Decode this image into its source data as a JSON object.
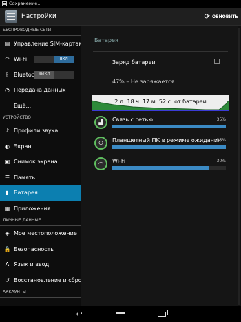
{
  "statusbar": {
    "notification": "Сохранение..."
  },
  "actionbar": {
    "title": "Настройки",
    "refresh_label": "ОБНОВИТЬ"
  },
  "sidebar": {
    "sections": [
      {
        "header": "БЕСПРОВОДНЫЕ СЕТИ",
        "items": [
          {
            "name": "sim",
            "icon": "sim-card-icon",
            "label": "Управление SIM-картами"
          },
          {
            "name": "wifi",
            "icon": "wifi-icon",
            "label": "Wi-Fi",
            "toggle": {
              "state": "on",
              "on_label": "ВКЛ",
              "off_label": ""
            }
          },
          {
            "name": "bluetooth",
            "icon": "bluetooth-icon",
            "label": "Bluetooth",
            "toggle": {
              "state": "off",
              "on_label": "",
              "off_label": "ВЫКЛ"
            }
          },
          {
            "name": "data",
            "icon": "data-transfer-icon",
            "label": "Передача данных"
          },
          {
            "name": "more",
            "icon": "",
            "label": "Ещё..."
          }
        ]
      },
      {
        "header": "УСТРОЙСТВО",
        "items": [
          {
            "name": "sound",
            "icon": "sound-profile-icon",
            "label": "Профили звука"
          },
          {
            "name": "display",
            "icon": "display-icon",
            "label": "Экран"
          },
          {
            "name": "screenshot",
            "icon": "camera-icon",
            "label": "Снимок экрана"
          },
          {
            "name": "storage",
            "icon": "storage-icon",
            "label": "Память"
          },
          {
            "name": "battery",
            "icon": "battery-icon",
            "label": "Батарея",
            "selected": true
          },
          {
            "name": "apps",
            "icon": "apps-icon",
            "label": "Приложения"
          }
        ]
      },
      {
        "header": "ЛИЧНЫЕ ДАННЫЕ",
        "items": [
          {
            "name": "location",
            "icon": "location-icon",
            "label": "Мое местоположение"
          },
          {
            "name": "security",
            "icon": "lock-icon",
            "label": "Безопасность"
          },
          {
            "name": "language",
            "icon": "language-icon",
            "label": "Язык и ввод"
          },
          {
            "name": "backup",
            "icon": "backup-icon",
            "label": "Восстановление и сброс"
          }
        ]
      },
      {
        "header": "АККАУНТЫ",
        "items": []
      }
    ]
  },
  "battery_panel": {
    "title": "Батарея",
    "charge_label": "Заряд батареи",
    "charge_checked": false,
    "status": "47% – Не заряжается",
    "graph_label": "2 д. 18 ч. 17 м. 52 с. от батареи",
    "usage": [
      {
        "name": "network",
        "icon": "signal-icon",
        "label": "Связь с сетью",
        "percent_text": "35%",
        "fraction": 0.35
      },
      {
        "name": "standby",
        "icon": "power-icon",
        "label": "Планшетный ПК в режиме ожидания",
        "percent_text": "35%",
        "fraction": 0.35
      },
      {
        "name": "wifi",
        "icon": "wifi-icon",
        "label": "Wi-Fi",
        "percent_text": "30%",
        "fraction": 0.3
      }
    ]
  },
  "colors": {
    "accent": "#0c7fb0",
    "bar": "#3b8ac4",
    "ring": "#5fbf5f"
  }
}
